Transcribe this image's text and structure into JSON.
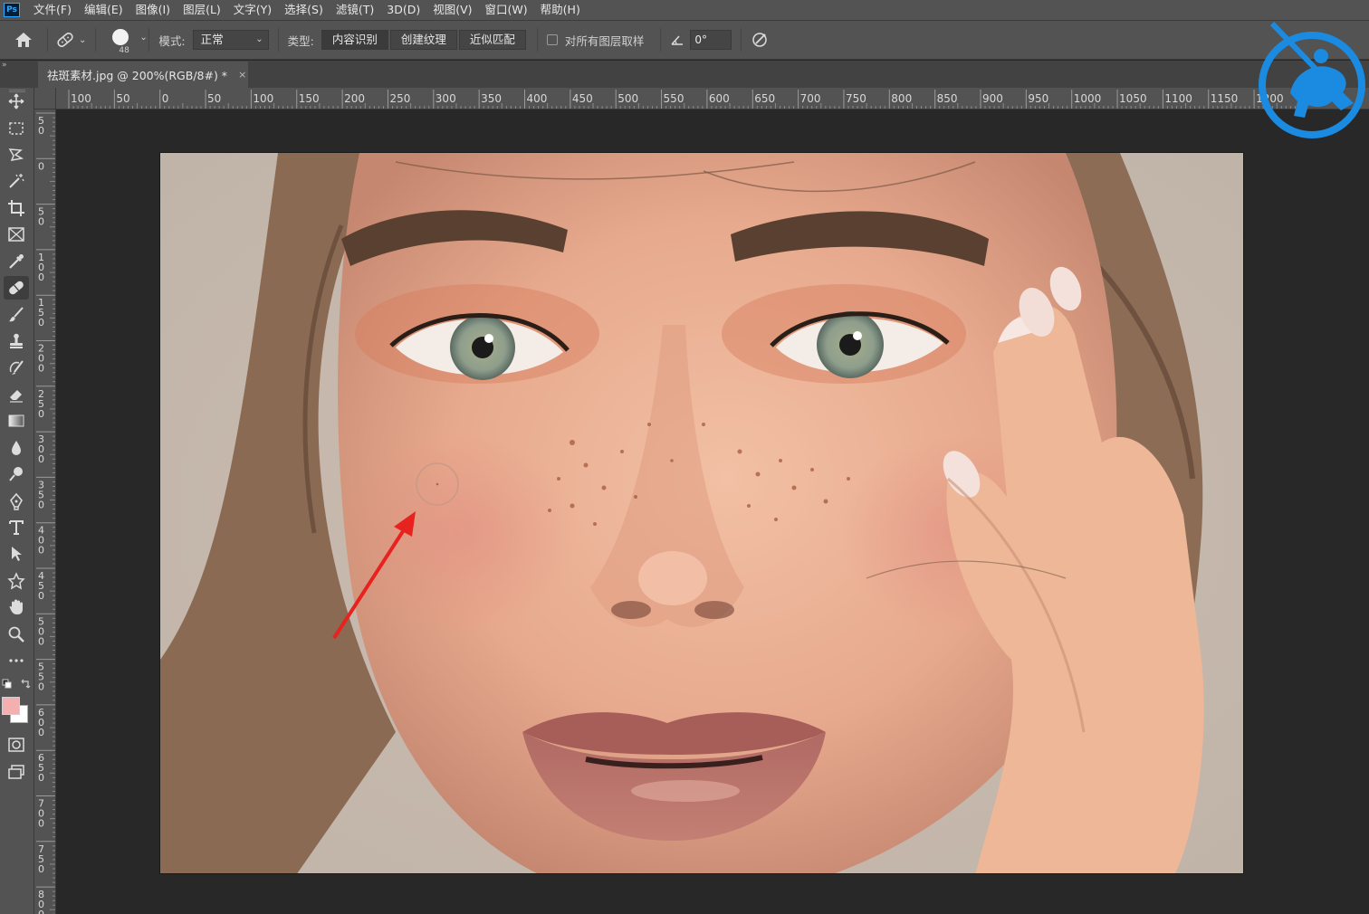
{
  "menu": [
    "文件(F)",
    "编辑(E)",
    "图像(I)",
    "图层(L)",
    "文字(Y)",
    "选择(S)",
    "滤镜(T)",
    "3D(D)",
    "视图(V)",
    "窗口(W)",
    "帮助(H)"
  ],
  "options": {
    "brush_size": "48",
    "mode_label": "模式:",
    "mode_value": "正常",
    "type_label": "类型:",
    "type_buttons": [
      "内容识别",
      "创建纹理",
      "近似匹配"
    ],
    "sample_all_label": "对所有图层取样",
    "angle_value": "0°"
  },
  "tab": {
    "title": "祛斑素材.jpg @ 200%(RGB/8#) *",
    "close": "×"
  },
  "panel_toggle": "»",
  "rulers": {
    "horizontal": [
      "100",
      "50",
      "0",
      "50",
      "100",
      "150",
      "200",
      "250",
      "300",
      "350",
      "400",
      "450",
      "500",
      "550",
      "600",
      "650",
      "700",
      "750",
      "800",
      "850",
      "900",
      "950",
      "1000",
      "1050",
      "1100",
      "1150",
      "1200"
    ],
    "vertical": [
      "50",
      "0",
      "50",
      "100",
      "150",
      "200",
      "250",
      "300",
      "350",
      "400",
      "450",
      "500",
      "550",
      "600",
      "650",
      "700",
      "750",
      "800"
    ]
  },
  "colors": {
    "foreground": "#f4b0b0",
    "background": "#ffffff",
    "annotation_arrow": "#e8221f",
    "watermark": "#1a8be0"
  },
  "tools": [
    "move-icon",
    "marquee-icon",
    "lasso-icon",
    "magic-wand-icon",
    "crop-icon",
    "frame-icon",
    "eyedropper-icon",
    "spot-healing-brush-icon",
    "brush-icon",
    "clone-stamp-icon",
    "history-brush-icon",
    "eraser-icon",
    "gradient-icon",
    "blur-icon",
    "dodge-icon",
    "pen-icon",
    "type-icon",
    "path-selection-icon",
    "shape-icon",
    "hand-icon",
    "zoom-icon",
    "more-tools-icon",
    "quick-mask-icon",
    "screen-mode-icon"
  ]
}
